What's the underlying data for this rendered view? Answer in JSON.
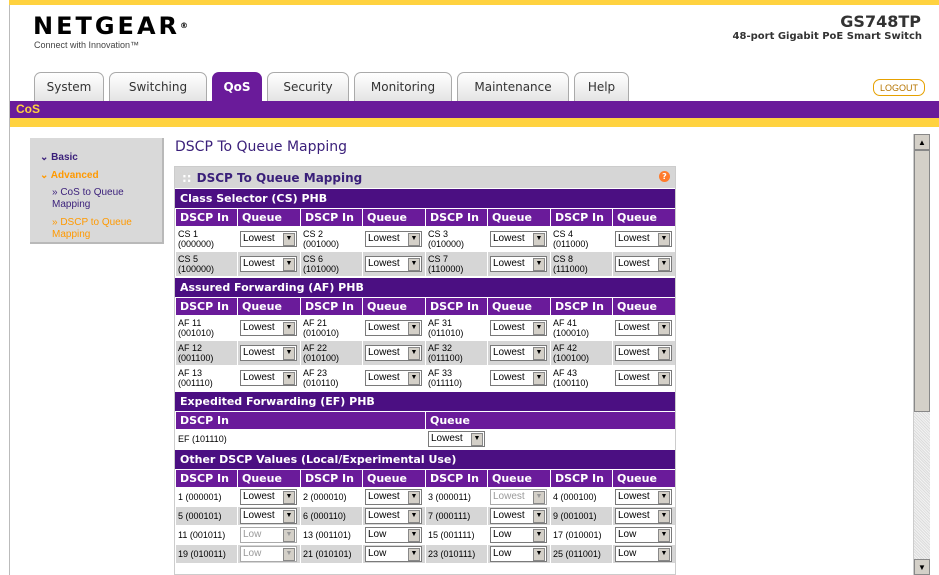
{
  "header": {
    "brand": "NETGEAR",
    "brand_mark": "®",
    "tagline": "Connect with Innovation™",
    "model": "GS748TP",
    "model_desc": "48-port Gigabit PoE Smart Switch",
    "logout": "LOGOUT"
  },
  "tabs": [
    {
      "label": "System"
    },
    {
      "label": "Switching"
    },
    {
      "label": "QoS",
      "active": true
    },
    {
      "label": "Security"
    },
    {
      "label": "Monitoring"
    },
    {
      "label": "Maintenance"
    },
    {
      "label": "Help"
    }
  ],
  "subnav": {
    "label": "CoS"
  },
  "sidebar": {
    "basic": "Basic",
    "advanced": "Advanced",
    "items": [
      "» CoS to Queue Mapping",
      "» DSCP to Queue Mapping"
    ]
  },
  "page": {
    "title": "DSCP To Queue Mapping",
    "panel_title": "DSCP To Queue Mapping",
    "help_icon": "?"
  },
  "headers": {
    "dscp_in": "DSCP In",
    "queue": "Queue"
  },
  "cs": {
    "title": "Class Selector (CS) PHB",
    "rows": [
      [
        {
          "dscp": "CS 1",
          "bits": "(000000)",
          "queue": "Lowest"
        },
        {
          "dscp": "CS 2",
          "bits": "(001000)",
          "queue": "Lowest"
        },
        {
          "dscp": "CS 3",
          "bits": "(010000)",
          "queue": "Lowest"
        },
        {
          "dscp": "CS 4",
          "bits": "(011000)",
          "queue": "Lowest"
        }
      ],
      [
        {
          "dscp": "CS 5",
          "bits": "(100000)",
          "queue": "Lowest"
        },
        {
          "dscp": "CS 6",
          "bits": "(101000)",
          "queue": "Lowest"
        },
        {
          "dscp": "CS 7",
          "bits": "(110000)",
          "queue": "Lowest"
        },
        {
          "dscp": "CS 8",
          "bits": "(111000)",
          "queue": "Lowest"
        }
      ]
    ]
  },
  "af": {
    "title": "Assured Forwarding (AF) PHB",
    "rows": [
      [
        {
          "dscp": "AF 11",
          "bits": "(001010)",
          "queue": "Lowest"
        },
        {
          "dscp": "AF 21",
          "bits": "(010010)",
          "queue": "Lowest"
        },
        {
          "dscp": "AF 31",
          "bits": "(011010)",
          "queue": "Lowest"
        },
        {
          "dscp": "AF 41",
          "bits": "(100010)",
          "queue": "Lowest"
        }
      ],
      [
        {
          "dscp": "AF 12",
          "bits": "(001100)",
          "queue": "Lowest"
        },
        {
          "dscp": "AF 22",
          "bits": "(010100)",
          "queue": "Lowest"
        },
        {
          "dscp": "AF 32",
          "bits": "(011100)",
          "queue": "Lowest"
        },
        {
          "dscp": "AF 42",
          "bits": "(100100)",
          "queue": "Lowest"
        }
      ],
      [
        {
          "dscp": "AF 13",
          "bits": "(001110)",
          "queue": "Lowest"
        },
        {
          "dscp": "AF 23",
          "bits": "(010110)",
          "queue": "Lowest"
        },
        {
          "dscp": "AF 33",
          "bits": "(011110)",
          "queue": "Lowest"
        },
        {
          "dscp": "AF 43",
          "bits": "(100110)",
          "queue": "Lowest"
        }
      ]
    ]
  },
  "ef": {
    "title": "Expedited Forwarding (EF) PHB",
    "dscp": "EF (101110)",
    "queue": "Lowest"
  },
  "other": {
    "title": "Other DSCP Values (Local/Experimental Use)",
    "rows": [
      [
        {
          "dscp": "1 (000001)",
          "queue": "Lowest"
        },
        {
          "dscp": "2 (000010)",
          "queue": "Lowest"
        },
        {
          "dscp": "3 (000011)",
          "queue": "Lowest",
          "disabled": true
        },
        {
          "dscp": "4 (000100)",
          "queue": "Lowest"
        }
      ],
      [
        {
          "dscp": "5 (000101)",
          "queue": "Lowest"
        },
        {
          "dscp": "6 (000110)",
          "queue": "Lowest"
        },
        {
          "dscp": "7 (000111)",
          "queue": "Lowest"
        },
        {
          "dscp": "9 (001001)",
          "queue": "Lowest"
        }
      ],
      [
        {
          "dscp": "11 (001011)",
          "queue": "Low",
          "disabled": true
        },
        {
          "dscp": "13 (001101)",
          "queue": "Low"
        },
        {
          "dscp": "15 (001111)",
          "queue": "Low"
        },
        {
          "dscp": "17 (010001)",
          "queue": "Low"
        }
      ],
      [
        {
          "dscp": "19 (010011)",
          "queue": "Low",
          "disabled": true
        },
        {
          "dscp": "21 (010101)",
          "queue": "Low"
        },
        {
          "dscp": "23 (010111)",
          "queue": "Low"
        },
        {
          "dscp": "25 (011001)",
          "queue": "Low"
        }
      ]
    ]
  },
  "colors": {
    "purple": "#6a1b9a",
    "dark_purple": "#4b0f82",
    "accent": "#ffd23f",
    "orange": "#ff9900"
  }
}
